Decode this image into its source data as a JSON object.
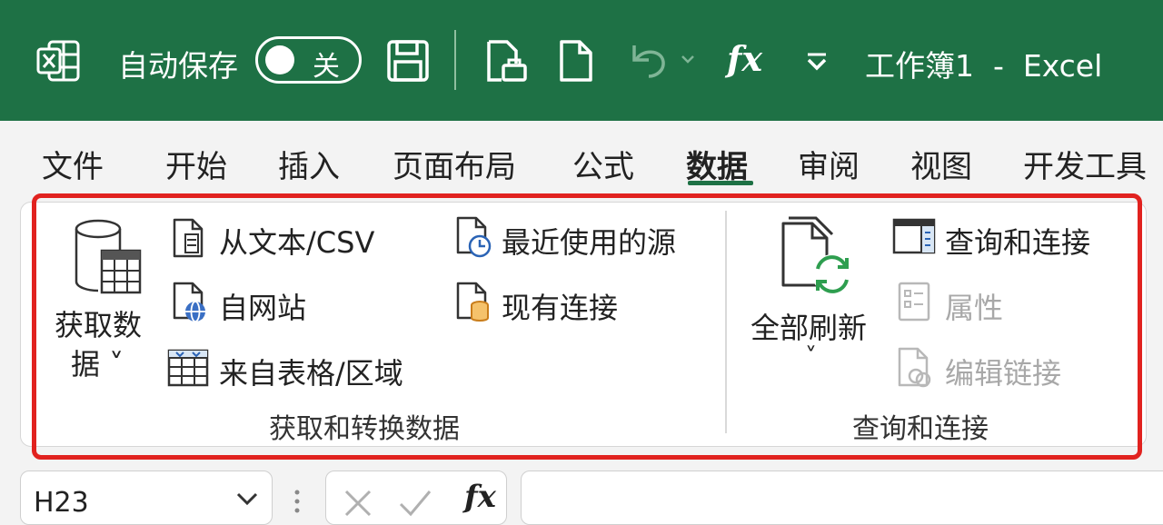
{
  "titlebar": {
    "autosave_label": "自动保存",
    "toggle_state": "关",
    "doc_title": "工作簿1  -  Excel",
    "fx_label": "fx"
  },
  "tabs": [
    "文件",
    "开始",
    "插入",
    "页面布局",
    "公式",
    "数据",
    "审阅",
    "视图",
    "开发工具"
  ],
  "active_tab": "数据",
  "ribbon": {
    "get_data": {
      "line1": "获取数",
      "line2": "据 ˅"
    },
    "from_text": "从文本/CSV",
    "from_web": "自网站",
    "from_table": "来自表格/区域",
    "recent_sources": "最近使用的源",
    "existing_connections": "现有连接",
    "group1_label": "获取和转换数据",
    "refresh_all": "全部刷新",
    "refresh_all_arrow": "˅",
    "queries_connections": "查询和连接",
    "properties": "属性",
    "edit_links": "编辑链接",
    "group2_label": "查询和连接"
  },
  "formula_bar": {
    "name_box": "H23",
    "fx_label": "fx"
  },
  "colors": {
    "excel_green": "#1e7145",
    "highlight_red": "#e1221f",
    "refresh_green": "#2e9e4f"
  }
}
